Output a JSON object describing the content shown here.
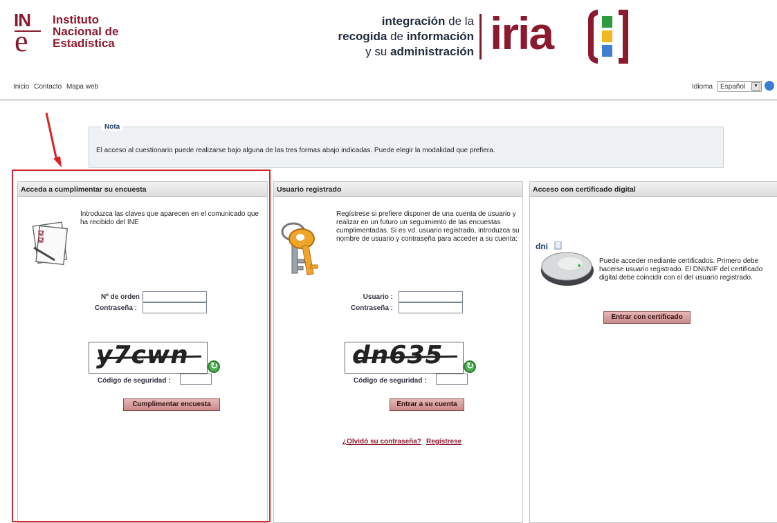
{
  "header": {
    "ine_mark_in": "IN",
    "ine_mark_e": "e",
    "ine_name": [
      "Instituto",
      "Nacional de",
      "Estadística"
    ],
    "iria_line1": [
      "integración",
      " de la"
    ],
    "iria_line2": [
      "recogida",
      " de ",
      "información"
    ],
    "iria_line3": [
      "y su ",
      "administración"
    ],
    "iria_word": "iria",
    "iria_colors": [
      "#2e9a3e",
      "#f2b81e",
      "#3f7fd1"
    ]
  },
  "nav": {
    "items": [
      "Inicio",
      "Contacto",
      "Mapa web"
    ],
    "language_label": "Idioma",
    "language_value": "Español"
  },
  "note": {
    "title": "Nota",
    "text": "El acceso al cuestionario puede realizarse bajo alguna de las tres formas abajo indicadas. Puede elegir la modalidad que prefiera."
  },
  "panel1": {
    "title": "Acceda a cumplimentar su encuesta",
    "intro": "Introduzca las claves que aparecen en el comunicado que ha recibido del INE",
    "order_label": "Nº de orden :",
    "password_label": "Contraseña :",
    "captcha_text": "y7cwn",
    "security_label": "Código de seguridad :",
    "submit": "Cumplimentar encuesta"
  },
  "panel2": {
    "title": "Usuario registrado",
    "intro": "Regístrese si prefiere disponer de una cuenta de usuario y realizar en un futuro un seguimiento de las encuestas cumplimentadas. Si es vd. usuario registrado, introduzca su nombre de usuario y contraseña para acceder a su cuenta:",
    "user_label": "Usuario :",
    "password_label": "Contraseña :",
    "captcha_text": "dn635",
    "security_label": "Código de seguridad :",
    "submit": "Entrar a su cuenta",
    "forgot_link": "¿Olvidó su contraseña?",
    "register_link": "Regístrese"
  },
  "panel3": {
    "title": "Acceso con certificado digital",
    "dni_logo": "dni",
    "intro": "Puede acceder mediante certificados. Primero debe hacerse usuario registrado. El DNI/NIF del certificado digital debe coincidir con el del usuario registrado.",
    "submit": "Entrar con certificado"
  }
}
